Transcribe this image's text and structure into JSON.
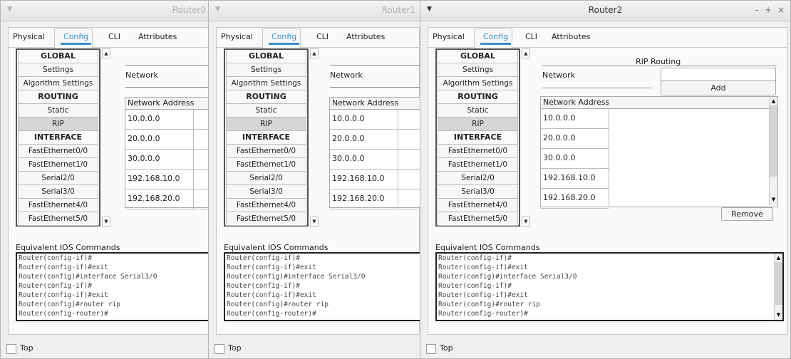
{
  "tabs": [
    "Physical",
    "Config",
    "CLI",
    "Attributes"
  ],
  "nav": [
    {
      "label": "GLOBAL",
      "type": "head"
    },
    {
      "label": "Settings",
      "type": "item"
    },
    {
      "label": "Algorithm Settings",
      "type": "item"
    },
    {
      "label": "ROUTING",
      "type": "head"
    },
    {
      "label": "Static",
      "type": "item"
    },
    {
      "label": "RIP",
      "type": "selected"
    },
    {
      "label": "INTERFACE",
      "type": "head"
    },
    {
      "label": "FastEthernet0/0",
      "type": "item"
    },
    {
      "label": "FastEthernet1/0",
      "type": "item"
    },
    {
      "label": "Serial2/0",
      "type": "item"
    },
    {
      "label": "Serial3/0",
      "type": "item"
    },
    {
      "label": "FastEthernet4/0",
      "type": "item"
    },
    {
      "label": "FastEthernet5/0",
      "type": "item"
    }
  ],
  "network_label": "Network",
  "network_address_header": "Network Address",
  "networks": [
    "10.0.0.0",
    "20.0.0.0",
    "30.0.0.0",
    "192.168.10.0",
    "192.168.20.0"
  ],
  "ios_label": "Equivalent IOS Commands",
  "ios_lines": [
    "Router(config-if)#",
    "Router(config-if)#exit",
    "Router(config)#interface Serial3/0",
    "Router(config-if)#",
    "Router(config-if)#exit",
    "Router(config)#router rip",
    "Router(config-router)#"
  ],
  "top_label": "Top",
  "windows": [
    {
      "title": "Router0",
      "active": false
    },
    {
      "title": "Router1",
      "active": false
    },
    {
      "title": "Router2",
      "active": true
    }
  ],
  "rip_routing_title": "RIP Routing",
  "add_label": "Add",
  "remove_label": "Remove",
  "window_controls": {
    "minimize": "–",
    "maximize": "+",
    "close": "×"
  },
  "icons": {
    "menu_arrow": "▼",
    "scroll_up": "▲",
    "scroll_down": "▼"
  },
  "colors": {
    "accent": "#3a8ed0"
  }
}
